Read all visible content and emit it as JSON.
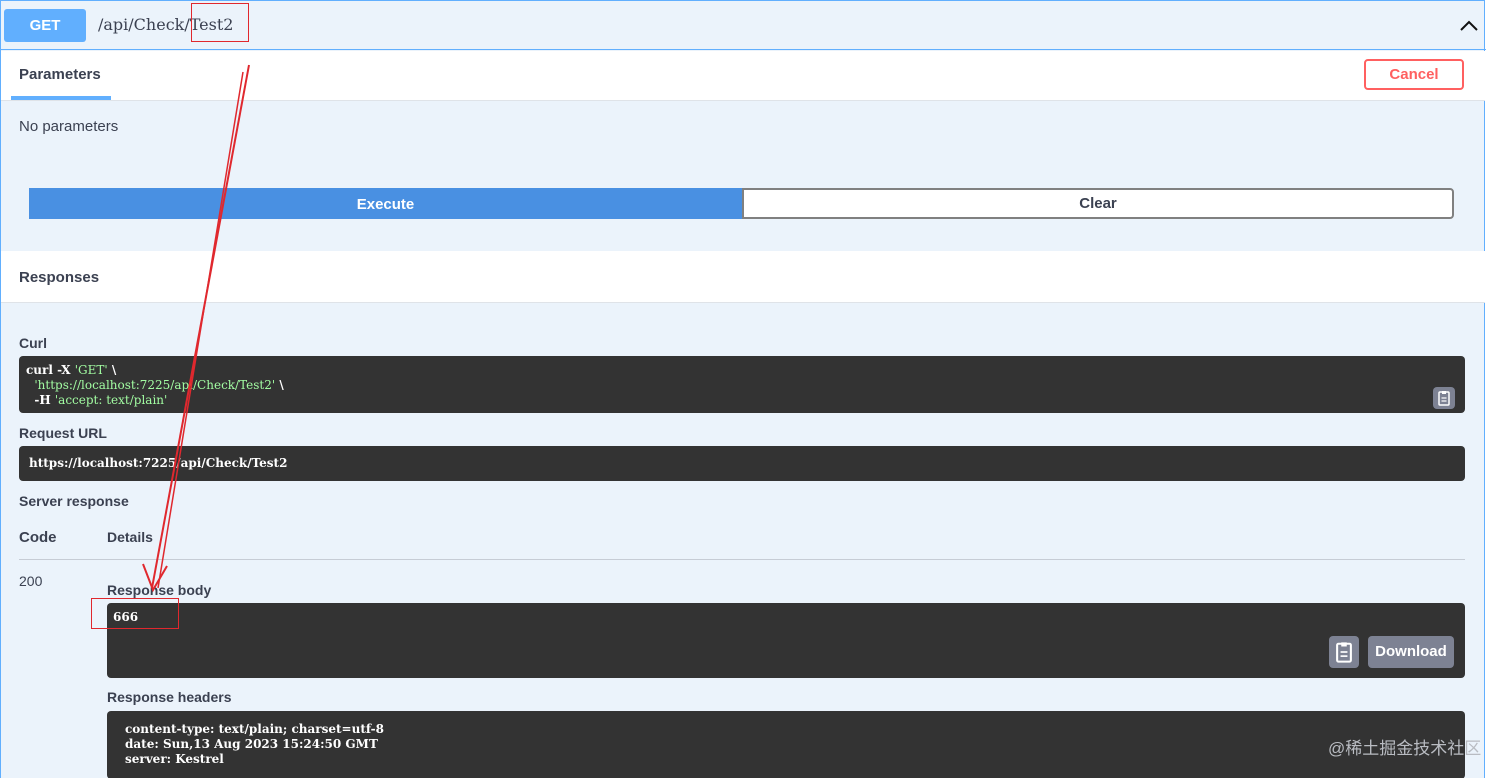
{
  "operation": {
    "method": "GET",
    "path_prefix": "/api/Check/",
    "path_highlight": "Test2"
  },
  "parameters": {
    "tab_label": "Parameters",
    "cancel_label": "Cancel",
    "no_params_text": "No parameters"
  },
  "actions": {
    "execute_label": "Execute",
    "clear_label": "Clear"
  },
  "responses": {
    "title": "Responses",
    "curl_label": "Curl",
    "curl_line1_cmd": "curl -X ",
    "curl_line1_str": "'GET'",
    "curl_line1_end": " \\",
    "curl_line2_str": "'https://localhost:7225/api/Check/Test2'",
    "curl_line2_end": " \\",
    "curl_line3_cmd": "  -H ",
    "curl_line3_str": "'accept: text/plain'",
    "request_url_label": "Request URL",
    "request_url": "https://localhost:7225/api/Check/Test2",
    "server_response_label": "Server response",
    "code_header": "Code",
    "details_header": "Details",
    "status_code": "200",
    "response_body_label": "Response body",
    "response_body": "666",
    "download_label": "Download",
    "response_headers_label": "Response headers",
    "header_line1": "content-type: text/plain; charset=utf-8",
    "header_line2": "date: Sun,13 Aug 2023 15:24:50 GMT",
    "header_line3": "server: Kestrel"
  },
  "watermark": "@稀土掘金技术社区",
  "colors": {
    "get_blue": "#61affe",
    "execute_blue": "#4990e2",
    "cancel_red": "#ff6060",
    "annotation_red": "#e0282e",
    "code_bg": "#333333",
    "string_green": "#a2fca2"
  },
  "icons": [
    "chevron-up-icon",
    "copy-icon"
  ]
}
